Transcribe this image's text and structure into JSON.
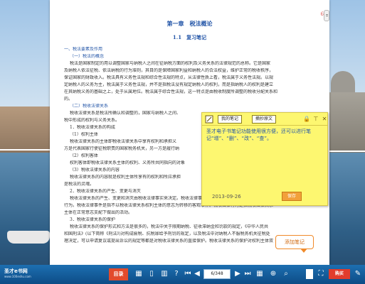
{
  "page": {
    "page_number": "6",
    "chapter_title": "第一章　税法概论",
    "section_title": "1.1　复习笔记",
    "lines": [
      {
        "text": "一、税法要素及作用",
        "heading": true
      },
      {
        "text": "（一）税法的概念",
        "heading": true,
        "indent": true
      },
      {
        "text": "税法是国家制定的用以调整国家与纳税人之间在征纳税方面的权利及义务关系的法律规范的总称。它是国家",
        "indent": true
      },
      {
        "text": "及纳税人依法征税、依法纳税的行为准则，其目的是保障国家利益和纳税人的合法权益，维护正常的税收秩序，"
      },
      {
        "text": "保证国家的财政收入。税法具有义务性法规和综合性法规的特点，从法律性质上看，税法属于义务性法规。以规"
      },
      {
        "text": "定纳税人的义务为主，税法属于义务性法规，并不是指税法没有规定纳税人的权利，而是指纳税人的权利是建立"
      },
      {
        "text": "在其纳税义务的基础之上，处于从属地位。税法属于综合性法规，这一特点是由税收制度所调整的税收分配关系和"
      },
      {
        "text": "的。"
      },
      {
        "text": "（二）税收法律关系",
        "heading": true,
        "indent": true
      },
      {
        "text": "税收法律关系是税法所确认和调整的，国家与纳税人之间、",
        "indent": true
      },
      {
        "text": "税中形成的权利与义务关系。"
      },
      {
        "text": "1．税收法律关系的构成",
        "indent": true
      },
      {
        "text": "（1）权利主体",
        "indent": true
      },
      {
        "text": "税收法律关系的主体即税收法律关系中享有权利和承担义",
        "indent": true
      },
      {
        "text": "方是代表国家行使征税职责的国家税务机关，另一方是履行纳"
      },
      {
        "text": "（2）权利客体",
        "indent": true
      },
      {
        "text": "权利客体即税收法律关系主体的权利、义务所共同指向的对象",
        "indent": true
      },
      {
        "text": "（3）税收法律关系的内容",
        "indent": true
      },
      {
        "text": "税收法律关系的内容就是权利主体所享有的权利和所应承担",
        "indent": true
      },
      {
        "text": "是税法的灵魂。"
      },
      {
        "text": "2．税收法律关系的产生、变更与消灭",
        "indent": true
      },
      {
        "text": "税收法律关系的产生、变更和消灭由税收法律事实来决定。税收法律事实可以分为税收法律事件和税收法律",
        "indent": true
      },
      {
        "text": "行为。税收法律事件是指不以税收法律关系权利主体的意志为转移的客观事件。税收法律行为是指税收法律关系"
      },
      {
        "text": "主体在正常意志支配下做出的活动。"
      },
      {
        "text": "3．税收法律关系的保护",
        "indent": true
      },
      {
        "text": "税收法律关系的保护形式和方法是很多的，税法中关于限期纳税、征收滞纳金和罚款的规定，《中华人民共",
        "indent": true
      },
      {
        "text": "和国刑法》(以下简称《刑法》)对构成偷税、抗税罪给予刑罚的规定，以及税法中对纳税人不服税务机关征税处"
      },
      {
        "text": "理决定，可以申请复议或提出诉讼的规定等都是对税收法律关系的直接保护。税收法律关系的保护对权利主体双"
      }
    ]
  },
  "note_popup": {
    "my_notes_label": "我的笔记",
    "clip_label": "摘抄原文",
    "text": "圣才电子书笔记功能使用很方便，还可以进行笔记“增”、“删”、“改”、“查”。",
    "date": "2013-09-26",
    "save_label": "保存"
  },
  "add_note_bubble": "添加笔记",
  "toolbar": {
    "brand": "圣才e书网",
    "brand_url": "www.100eshu.com",
    "toc_label": "目录",
    "page_indicator": "6/348",
    "buy_label": "购买"
  },
  "icons": {
    "pencil": "pencil-icon",
    "lock": "lock-icon",
    "pin": "pin-icon",
    "close": "close-icon"
  }
}
